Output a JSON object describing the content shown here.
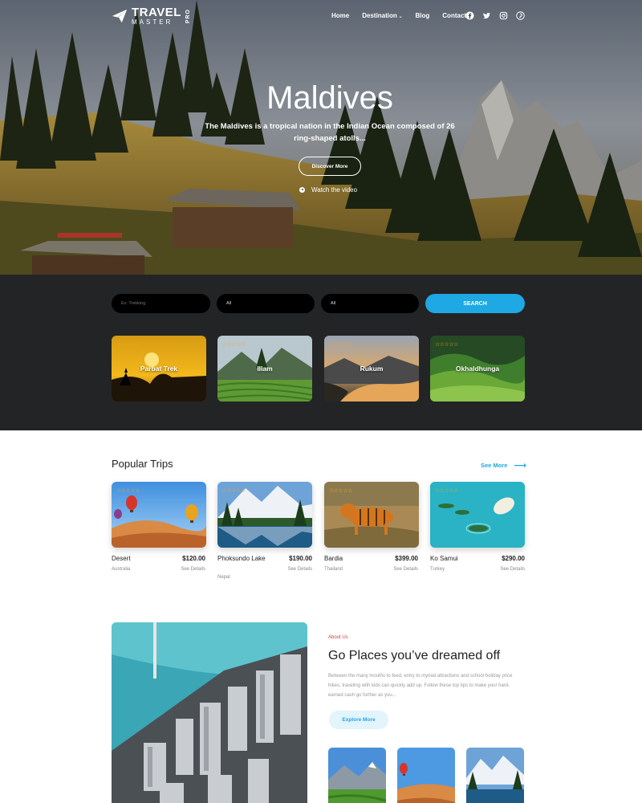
{
  "brand": {
    "line1": "TRAVEL",
    "line2": "MASTER",
    "tag": "PRO"
  },
  "nav": {
    "items": [
      "Home",
      "Destination",
      "Blog",
      "Contact"
    ],
    "dropdown_icon": "chevron-down-icon"
  },
  "socials": [
    "facebook-icon",
    "twitter-icon",
    "instagram-icon",
    "pinterest-icon"
  ],
  "hero": {
    "title": "Maldives",
    "description": "The Maldives is a tropical nation in the Indian Ocean composed of 26 ring-shaped atolls...",
    "discover_label": "Discover More",
    "watch_label": "Watch the video"
  },
  "search": {
    "keyword_placeholder": "Ex: Trekking",
    "destination_value": "All",
    "duration_value": "All",
    "button_label": "SEARCH"
  },
  "destinations": [
    {
      "name": "Parbat Trek",
      "stars": "☆☆☆☆☆"
    },
    {
      "name": "Illam",
      "stars": "☆☆☆☆☆"
    },
    {
      "name": "Rukum",
      "stars": "☆☆☆☆☆"
    },
    {
      "name": "Okhaldhunga",
      "stars": "☆☆☆☆☆"
    }
  ],
  "popular": {
    "title": "Popular Trips",
    "see_more": "See More",
    "trips": [
      {
        "name": "Desert",
        "price": "$120.00",
        "country": "Australia",
        "details": "See Details",
        "stars": "☆☆☆☆☆"
      },
      {
        "name": "Phoksundo Lake",
        "price": "$190.00",
        "country": "Nepal",
        "details": "See Details",
        "stars": "☆☆☆☆☆"
      },
      {
        "name": "Bardia",
        "price": "$399.00",
        "country": "Thailand",
        "details": "See Details",
        "stars": "☆☆☆☆☆"
      },
      {
        "name": "Ko Samui",
        "price": "$290.00",
        "country": "Turkey",
        "details": "See Details",
        "stars": "☆☆☆☆☆"
      }
    ]
  },
  "about": {
    "tag": "About Us",
    "title": "Go Places you’ve dreamed off",
    "text": "Between the many mouths to feed, entry to myriad attractions and school holiday price hikes, traveling with kids can quickly add up. Follow these top tips to make your hard-earned cash go further as you...",
    "button_label": "Explore More"
  },
  "colors": {
    "accent": "#1ea8e4",
    "dark_bg": "#232425",
    "star": "#f5a623",
    "about_tag": "#d23a3a"
  }
}
